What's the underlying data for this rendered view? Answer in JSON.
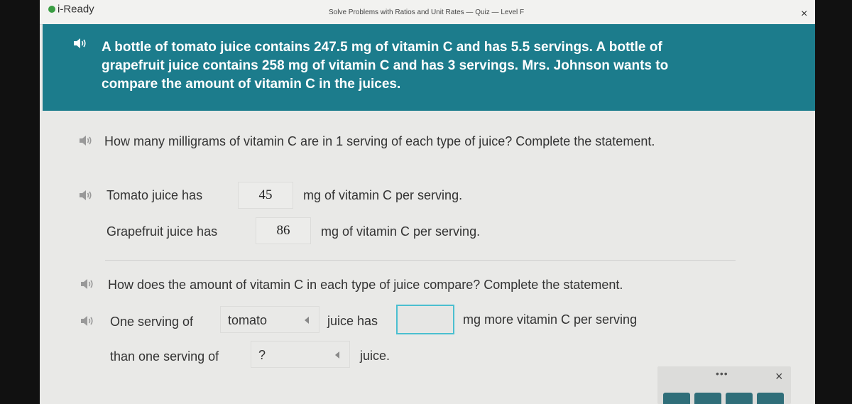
{
  "app": {
    "logo": "i-Ready",
    "title": "Solve Problems with Ratios and Unit Rates — Quiz — Level F",
    "close_icon": "×"
  },
  "stem": {
    "text": "A bottle of tomato juice contains 247.5 mg of vitamin C and has 5.5 servings. A bottle of grapefruit juice contains 258 mg of vitamin C and has 3 servings. Mrs. Johnson wants to compare the amount of vitamin C in the juices."
  },
  "part1": {
    "question": "How many milligrams of vitamin C are in 1 serving of each type of juice? Complete the statement.",
    "tomato_prefix": "Tomato juice has",
    "tomato_value": "45",
    "tomato_suffix": "mg of vitamin C per serving.",
    "grapefruit_prefix": "Grapefruit juice has",
    "grapefruit_value": "86",
    "grapefruit_suffix": "mg of vitamin C per serving."
  },
  "part2": {
    "question": "How does the amount of vitamin C in each type of juice compare? Complete the statement.",
    "line1_prefix": "One serving of",
    "dropdown1_value": "tomato",
    "line1_middle": "juice has",
    "line1_suffix": "mg more vitamin C per serving",
    "line2_prefix": "than one serving of",
    "dropdown2_value": "?",
    "line2_suffix": "juice."
  },
  "toolbar": {
    "more_icon": "•••",
    "close_icon": "×"
  },
  "colors": {
    "stem_bg": "#1c7c8c",
    "page_bg": "#e9e9e7",
    "focus_border": "#4bbfd0",
    "tool_key": "#2f6e79"
  },
  "icons": [
    "speaker-icon",
    "close-icon",
    "more-icon",
    "chevron-left-icon"
  ]
}
